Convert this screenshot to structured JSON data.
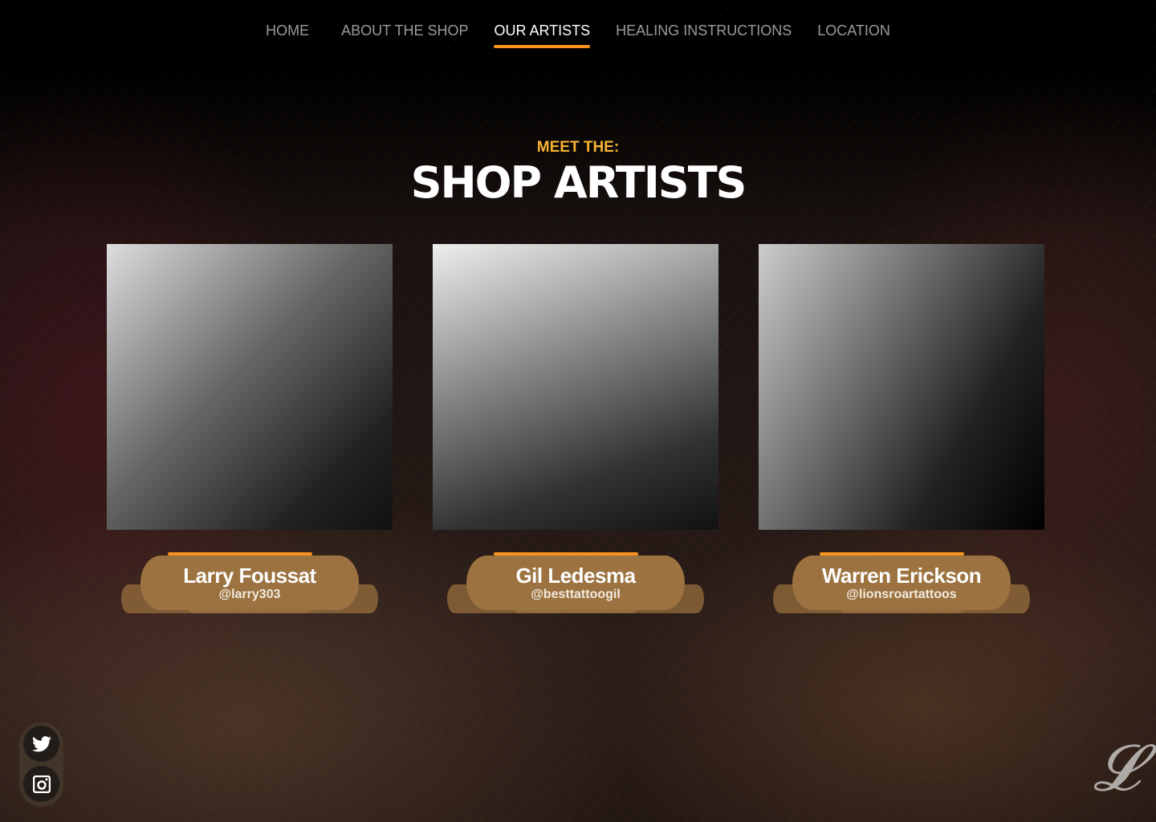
{
  "nav": {
    "items": [
      {
        "label": "HOME"
      },
      {
        "label": "ABOUT THE SHOP"
      },
      {
        "label": "OUR ARTISTS"
      },
      {
        "label": "HEALING INSTRUCTIONS"
      },
      {
        "label": "LOCATION"
      }
    ],
    "active": "OUR ARTISTS"
  },
  "heading": {
    "kicker": "MEET THE:",
    "title": "SHOP ARTISTS"
  },
  "artists": [
    {
      "name": "Larry Foussat",
      "handle": "@larry303"
    },
    {
      "name": "Gil Ledesma",
      "handle": "@besttattoogil"
    },
    {
      "name": "Warren Erickson",
      "handle": "@lionsroartattoos"
    }
  ],
  "social": [
    {
      "icon": "twitter-icon"
    },
    {
      "icon": "instagram-icon"
    }
  ],
  "colors": {
    "accent": "#f7931e",
    "kicker": "#f9b233",
    "banner": "#9c7340"
  }
}
